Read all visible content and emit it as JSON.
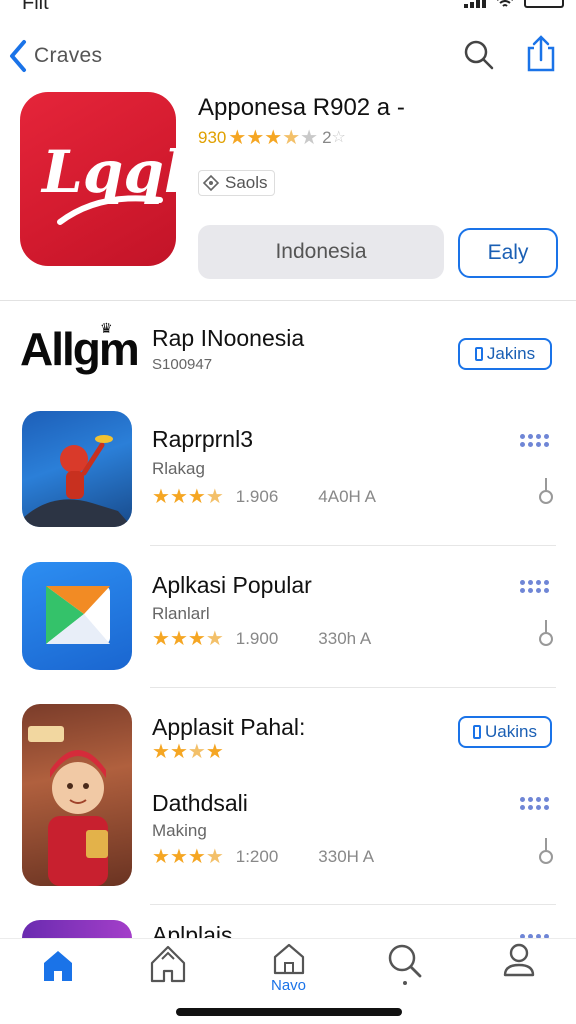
{
  "status_bar": {
    "left_text": "Flit"
  },
  "nav": {
    "back_label": "Craves"
  },
  "hero": {
    "title": "Apponesa R902 a -",
    "rating_value": "930",
    "rating_count": "2",
    "tag": "Saols",
    "primary_button": "Indonesia",
    "secondary_button": "Ealy",
    "icon_text": "Lqqk"
  },
  "featured": {
    "wordmark": "Allgm",
    "title": "Rap INoonesia",
    "subtitle": "S100947",
    "button_label": "Jakins"
  },
  "apps": [
    {
      "title": "Raprprnl3",
      "subtitle": "Rlakag",
      "rating": "1.906",
      "size": "4A0H A",
      "stars": 3.5
    },
    {
      "title": "Aplkasi Popular",
      "subtitle": "Rlanlarl",
      "rating": "1.900",
      "size": "330h A",
      "stars": 3.5
    },
    {
      "title": "Applasit Pahal:",
      "button_label": "Uakins"
    },
    {
      "title": "Dathdsali",
      "subtitle": "Making",
      "rating": "1:200",
      "size": "330H A",
      "stars": 3.5
    }
  ],
  "peek_row": {
    "title": "Aplplais"
  },
  "tabbar": {
    "tabs": [
      {
        "icon": "home-icon",
        "label": ""
      },
      {
        "icon": "puzzle-home-icon",
        "label": ""
      },
      {
        "icon": "house-outline-icon",
        "label": "Navo"
      },
      {
        "icon": "search-icon",
        "label": ""
      },
      {
        "icon": "person-icon",
        "label": ""
      }
    ]
  },
  "colors": {
    "accent": "#1a73e8",
    "star": "#f5a623",
    "hero_icon": "#d21a2e"
  }
}
